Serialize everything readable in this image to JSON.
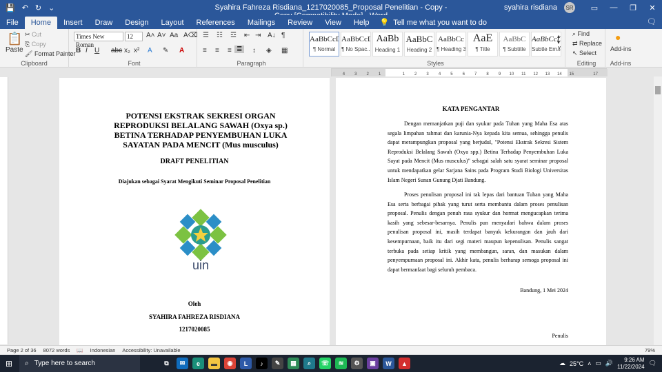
{
  "titlebar": {
    "title": "Syahira Fahreza Risdiana_1217020085_Proposal Penelitian - Copy - Copy [Compatibility Mode]  -  Word",
    "user": "syahira risdiana",
    "initials": "SR"
  },
  "tabs": [
    {
      "label": "File"
    },
    {
      "label": "Home"
    },
    {
      "label": "Insert"
    },
    {
      "label": "Draw"
    },
    {
      "label": "Design"
    },
    {
      "label": "Layout"
    },
    {
      "label": "References"
    },
    {
      "label": "Mailings"
    },
    {
      "label": "Review"
    },
    {
      "label": "View"
    },
    {
      "label": "Help"
    }
  ],
  "tellme": "Tell me what you want to do",
  "ribbon": {
    "clipboard": {
      "paste": "Paste",
      "cut": "Cut",
      "copy": "Copy",
      "format_painter": "Format Painter",
      "label": "Clipboard"
    },
    "font": {
      "name": "Times New Roman",
      "size": "12",
      "label": "Font"
    },
    "paragraph": {
      "label": "Paragraph"
    },
    "styles": {
      "label": "Styles",
      "items": [
        {
          "sample": "AaBbCcD",
          "name": "¶ Normal"
        },
        {
          "sample": "AaBbCcD",
          "name": "¶ No Spac..."
        },
        {
          "sample": "AaBb",
          "name": "Heading 1"
        },
        {
          "sample": "AaBbC",
          "name": "Heading 2"
        },
        {
          "sample": "AaBbCc",
          "name": "¶ Heading 3"
        },
        {
          "sample": "AaE",
          "name": "¶ Title"
        },
        {
          "sample": "AaBbC",
          "name": "¶ Subtitle"
        },
        {
          "sample": "AaBbCcD",
          "name": "Subtle Em..."
        }
      ]
    },
    "editing": {
      "find": "Find",
      "replace": "Replace",
      "select": "Select",
      "label": "Editing"
    },
    "addins": {
      "label": "Add-ins",
      "button": "Add-ins"
    }
  },
  "ruler": {
    "ticks": [
      "4",
      "3",
      "2",
      "1",
      "",
      "1",
      "2",
      "3",
      "4",
      "5",
      "6",
      "7",
      "8",
      "9",
      "10",
      "11",
      "12",
      "13",
      "14",
      "15",
      "",
      "17"
    ]
  },
  "page1": {
    "title": "POTENSI EKSTRAK SEKRESI ORGAN REPRODUKSI BELALANG SAWAH (Oxya sp.) BETINA TERHADAP PENYEMBUHAN LUKA SAYATAN PADA MENCIT (Mus musculus)",
    "draft": "DRAFT PENELITIAN",
    "subtitle": "Diajukan sebagai Syarat Mengikuti Seminar Proposal Penelitian",
    "logo_text": "uin",
    "by": "Oleh",
    "name": "SYAHIRA FAHREZA RISDIANA",
    "nim": "1217020085"
  },
  "page2": {
    "heading": "KATA PENGANTAR",
    "p1": "Dengan memanjatkan puji dan syukur pada Tuhan yang Maha Esa atas segala limpahan rahmat dan karunia-Nya kepada kita semua, sehingga penulis dapat merampungkan proposal yang berjudul, \"Potensi Ekstrak Sekresi Sistem Reproduksi Belalang Sawah (Oxya spp.) Betina Terhadap Penyembuhan Luka Sayat pada Mencit (Mus musculus)\" sebagai salah satu syarat seminar proposal untuk mendapatkan gelar Sarjana Sains pada Program Studi Biologi Universitas Islam Negeri Sunan Gunung Djati Bandung.",
    "p2": "Proses penulisan proposal ini tak lepas dari bantuan Tuhan yang Maha Esa serta berbagai pihak yang turut serta membantu dalam proses penulisan proposal. Penulis dengan penuh rasa syukur dan hormat mengucapkan terima kasih yang sebesar-besarnya. Penulis pun menyadari bahwa dalam proses penulisan proposal ini, masih terdapat banyak kekurangan dan jauh dari kesempurnaan, baik itu dari segi materi maupun kepenulisan. Penulis sangat terbuka pada setiap kritik yang membangun, saran, dan masukan dalam penyempurnaan proposal ini. Akhir kata, penulis berharap semoga proposal ini dapat bermanfaat bagi seluruh pembaca.",
    "date": "Bandung, 1 Mei 2024",
    "signer": "Penulis"
  },
  "status": {
    "page": "Page 2 of 36",
    "words": "8072 words",
    "language": "Indonesian",
    "accessibility": "Accessibility: Unavailable",
    "zoom": "79%"
  },
  "taskbar": {
    "search": "Type here to search",
    "weather": "25°C",
    "time": "9:26 AM",
    "date": "11/22/2024"
  }
}
